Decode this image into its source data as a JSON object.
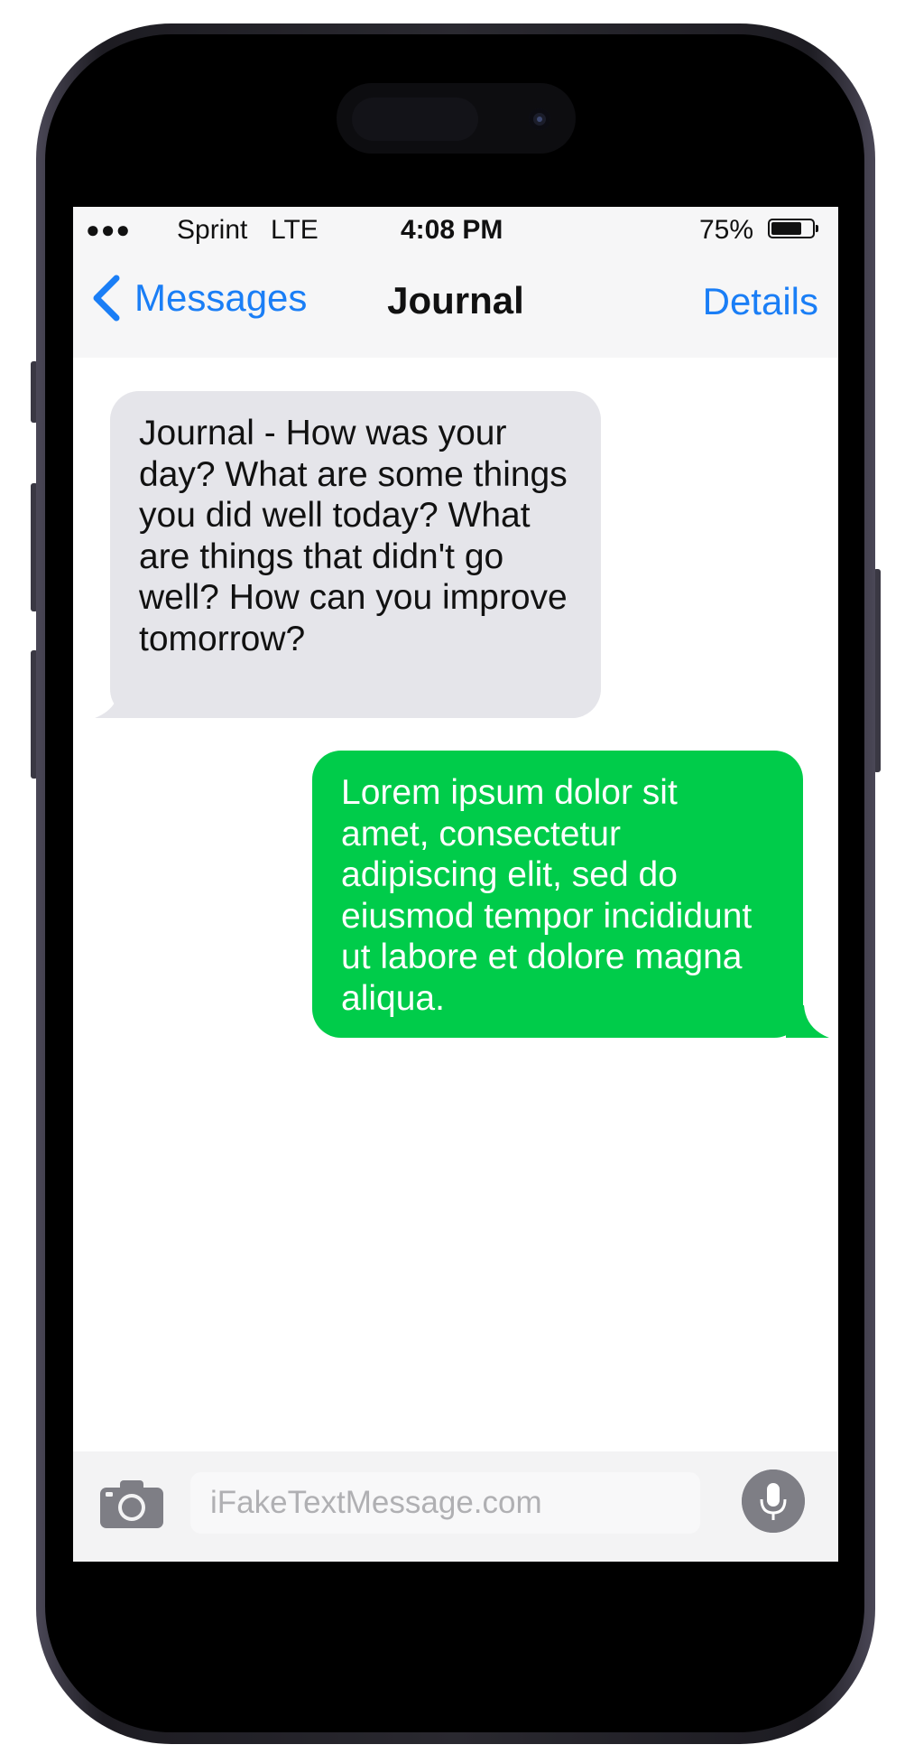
{
  "status_bar": {
    "signal": "●●●",
    "carrier": "Sprint",
    "network": "LTE",
    "time": "4:08 PM",
    "battery_percent_label": "75%",
    "battery_level": 0.75
  },
  "nav": {
    "back_label": "Messages",
    "title": "Journal",
    "details_label": "Details"
  },
  "messages": [
    {
      "direction": "incoming",
      "text": "Journal - How was your day? What are some things you did well today? What are things that didn't go well? How can you improve tomorrow?"
    },
    {
      "direction": "outgoing",
      "text": "Lorem ipsum dolor sit amet, consectetur adipiscing elit, sed do eiusmod tempor incididunt ut labore et dolore magna aliqua."
    }
  ],
  "composer": {
    "placeholder": "iFakeTextMessage.com"
  },
  "colors": {
    "accent": "#1a7ef6",
    "incoming_bubble": "#e5e5ea",
    "outgoing_bubble": "#00cc4a"
  },
  "icons": {
    "back": "chevron-left-icon",
    "camera": "camera-icon",
    "mic": "microphone-icon"
  }
}
